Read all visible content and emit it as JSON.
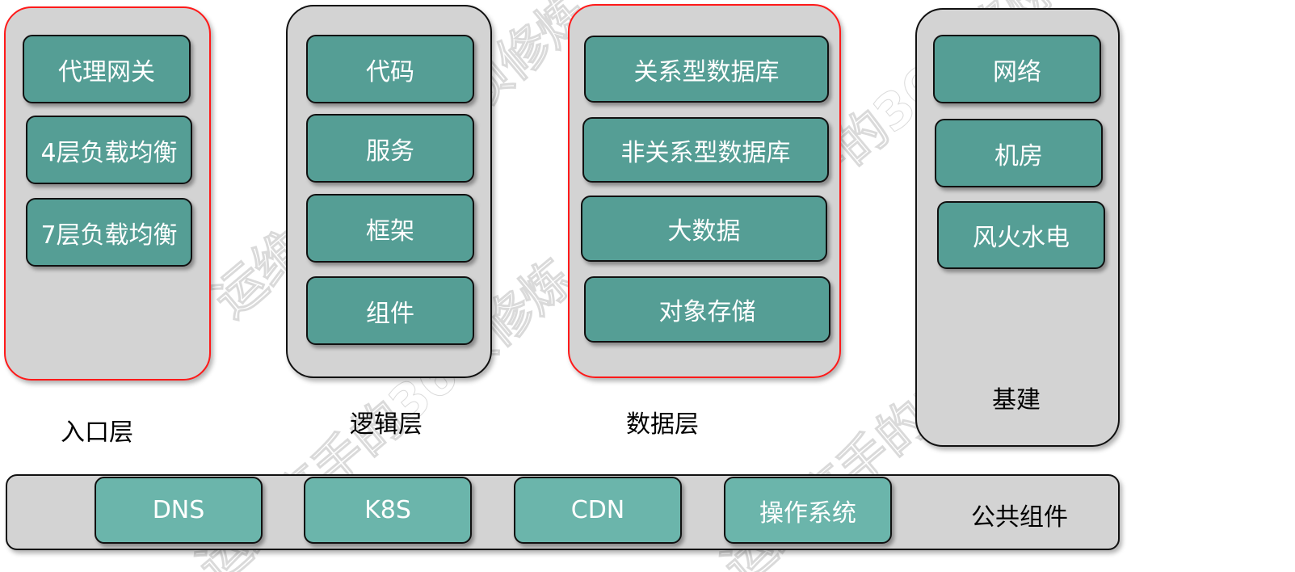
{
  "colors": {
    "group_bg": "#d3d3d3",
    "highlight_border": "#ff1a1a",
    "box": "#559e95",
    "box_light": "#6bb5ab"
  },
  "entry": {
    "label": "入口层",
    "items": [
      "代理网关",
      "4层负载均衡",
      "7层负载均衡"
    ]
  },
  "logic": {
    "label": "逻辑层",
    "items": [
      "代码",
      "服务",
      "框架",
      "组件"
    ]
  },
  "data": {
    "label": "数据层",
    "items": [
      "关系型数据库",
      "非关系型数据库",
      "大数据",
      "对象存储"
    ]
  },
  "infra": {
    "label": "基建",
    "items": [
      "网络",
      "机房",
      "风火水电"
    ]
  },
  "common": {
    "label": "公共组件",
    "items": [
      "DNS",
      "K8S",
      "CDN",
      "操作系统"
    ]
  },
  "watermark": "运维高手的36项修炼"
}
